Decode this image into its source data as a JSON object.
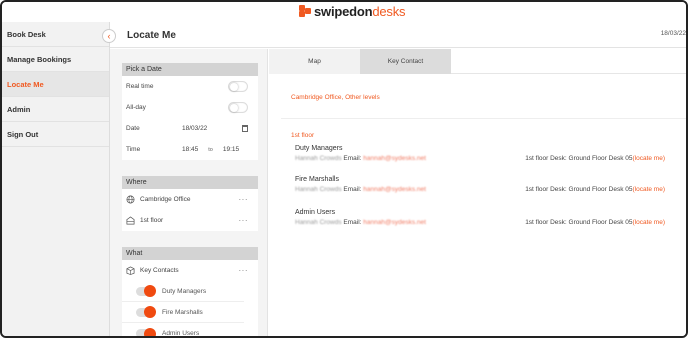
{
  "brand": {
    "name_part1": "swipedon",
    "name_part2": "desks"
  },
  "sidebar": {
    "items": [
      {
        "label": "Book Desk",
        "active": false
      },
      {
        "label": "Manage Bookings",
        "active": false
      },
      {
        "label": "Locate Me",
        "active": true
      },
      {
        "label": "Admin",
        "active": false
      },
      {
        "label": "Sign Out",
        "active": false
      }
    ],
    "collapse_glyph": "‹"
  },
  "header": {
    "title": "Locate Me",
    "date": "18/03/22"
  },
  "filters": {
    "pick_date": {
      "title": "Pick a Date",
      "real_time_label": "Real time",
      "all_day_label": "All-day",
      "date_label": "Date",
      "date_value": "18/03/22",
      "time_label": "Time",
      "time_from": "18:45",
      "time_to_label": "to",
      "time_to": "19:15"
    },
    "where": {
      "title": "Where",
      "office": "Cambridge Office",
      "floor": "1st floor",
      "more_glyph": "···"
    },
    "what": {
      "title": "What",
      "key_contacts_label": "Key Contacts",
      "more_glyph": "···",
      "groups": [
        "Duty Managers",
        "Fire Marshalls",
        "Admin Users"
      ]
    }
  },
  "main": {
    "tabs": [
      {
        "label": "Map",
        "active": true
      },
      {
        "label": "Key Contact",
        "active": false
      }
    ],
    "site_path": "Cambridge Office, Other levels",
    "floor_label": "1st floor",
    "contacts": [
      {
        "group": "Duty Managers",
        "person": "Hannah Crowds",
        "email_label": "Email:",
        "email": "hannah@sydesks.net",
        "desk_text": "1st floor Desk: Ground Floor Desk 05",
        "locate_label": "(locate me)"
      },
      {
        "group": "Fire Marshalls",
        "person": "Hannah Crowds",
        "email_label": "Email:",
        "email": "hannah@sydesks.net",
        "desk_text": "1st floor Desk: Ground Floor Desk 05",
        "locate_label": "(locate me)"
      },
      {
        "group": "Admin Users",
        "person": "Hannah Crowds",
        "email_label": "Email:",
        "email": "hannah@sydesks.net",
        "desk_text": "1st floor Desk: Ground Floor Desk 05",
        "locate_label": "(locate me)"
      }
    ]
  },
  "colors": {
    "accent": "#f05a22",
    "toggle_on": "#f04a10",
    "sidebar_bg": "#f2f2f2",
    "card_header": "#d3d3d3"
  },
  "icons": {
    "globe": "globe-icon",
    "building": "building-icon",
    "box": "box-icon",
    "calendar": "calendar-icon",
    "collapse": "chevron-left-icon"
  }
}
